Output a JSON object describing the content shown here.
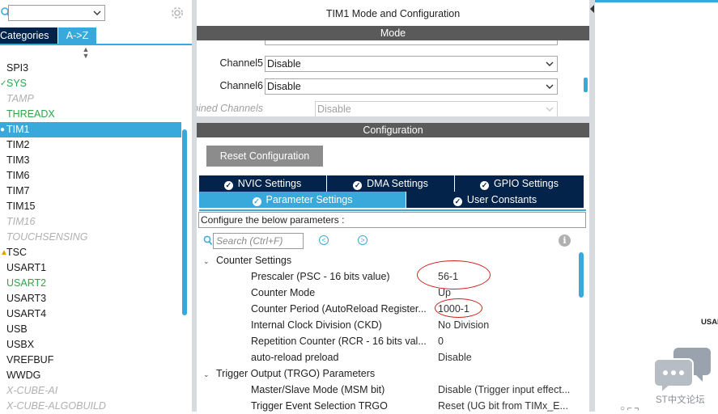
{
  "left_panel": {
    "combo_value": "",
    "tabs": {
      "categories": "Categories",
      "az": "A->Z"
    },
    "items": [
      {
        "label": "SPI3",
        "style": "normal"
      },
      {
        "label": "SYS",
        "style": "green",
        "mark": "✓"
      },
      {
        "label": "TAMP",
        "style": "grey"
      },
      {
        "label": "THREADX",
        "style": "green"
      },
      {
        "label": "TIM1",
        "style": "selected",
        "mark": "●"
      },
      {
        "label": "TIM2",
        "style": "normal"
      },
      {
        "label": "TIM3",
        "style": "normal"
      },
      {
        "label": "TIM6",
        "style": "normal"
      },
      {
        "label": "TIM7",
        "style": "normal"
      },
      {
        "label": "TIM15",
        "style": "normal"
      },
      {
        "label": "TIM16",
        "style": "grey"
      },
      {
        "label": "TOUCHSENSING",
        "style": "grey"
      },
      {
        "label": "TSC",
        "style": "normal",
        "mark": "▲"
      },
      {
        "label": "USART1",
        "style": "normal"
      },
      {
        "label": "USART2",
        "style": "green"
      },
      {
        "label": "USART3",
        "style": "normal"
      },
      {
        "label": "USART4",
        "style": "normal"
      },
      {
        "label": "USB",
        "style": "normal"
      },
      {
        "label": "USBX",
        "style": "normal"
      },
      {
        "label": "VREFBUF",
        "style": "normal"
      },
      {
        "label": "WWDG",
        "style": "normal"
      },
      {
        "label": "X-CUBE-AI",
        "style": "grey"
      },
      {
        "label": "X-CUBE-ALGOBUILD",
        "style": "grey"
      }
    ]
  },
  "mode": {
    "window_title": "TIM1 Mode and Configuration",
    "bar_title": "Mode",
    "rows": [
      {
        "label": "Channel5",
        "value": "Disable",
        "disabled": false
      },
      {
        "label": "Channel6",
        "value": "Disable",
        "disabled": false
      },
      {
        "label": "Combined Channels",
        "value": "Disable",
        "disabled": true
      }
    ]
  },
  "config": {
    "bar_title": "Configuration",
    "reset_label": "Reset Configuration",
    "tabs_row1": [
      "NVIC Settings",
      "DMA Settings",
      "GPIO Settings"
    ],
    "tabs_row2": [
      "Parameter Settings",
      "User Constants"
    ],
    "hint": "Configure the below parameters :",
    "search_placeholder": "Search (Ctrl+F)",
    "groups": [
      {
        "title": "Counter Settings",
        "params": [
          {
            "label": "Prescaler (PSC - 16 bits value)",
            "value": "56-1"
          },
          {
            "label": "Counter Mode",
            "value": "Up"
          },
          {
            "label": "Counter Period (AutoReload Register...",
            "value": "1000-1"
          },
          {
            "label": "Internal Clock Division (CKD)",
            "value": "No Division"
          },
          {
            "label": "Repetition Counter (RCR - 16 bits val...",
            "value": "0"
          },
          {
            "label": "auto-reload preload",
            "value": "Disable"
          }
        ]
      },
      {
        "title": "Trigger Output (TRGO) Parameters",
        "params": [
          {
            "label": "Master/Slave Mode (MSM bit)",
            "value": "Disable (Trigger input effect..."
          },
          {
            "label": "Trigger Event Selection TRGO",
            "value": "Reset (UG bit from TIMx_E..."
          }
        ]
      }
    ]
  },
  "right_panel": {
    "cut_label": "USAF",
    "chat_label": "ST中文论坛",
    "bottom_glyphs": "○   ⌐ ¬"
  },
  "colors": {
    "navy": "#03234b",
    "accent": "#39a9dc",
    "bar_grey": "#5a5a5a",
    "green": "#2aa84a",
    "annotation_red": "#d21e1e"
  }
}
